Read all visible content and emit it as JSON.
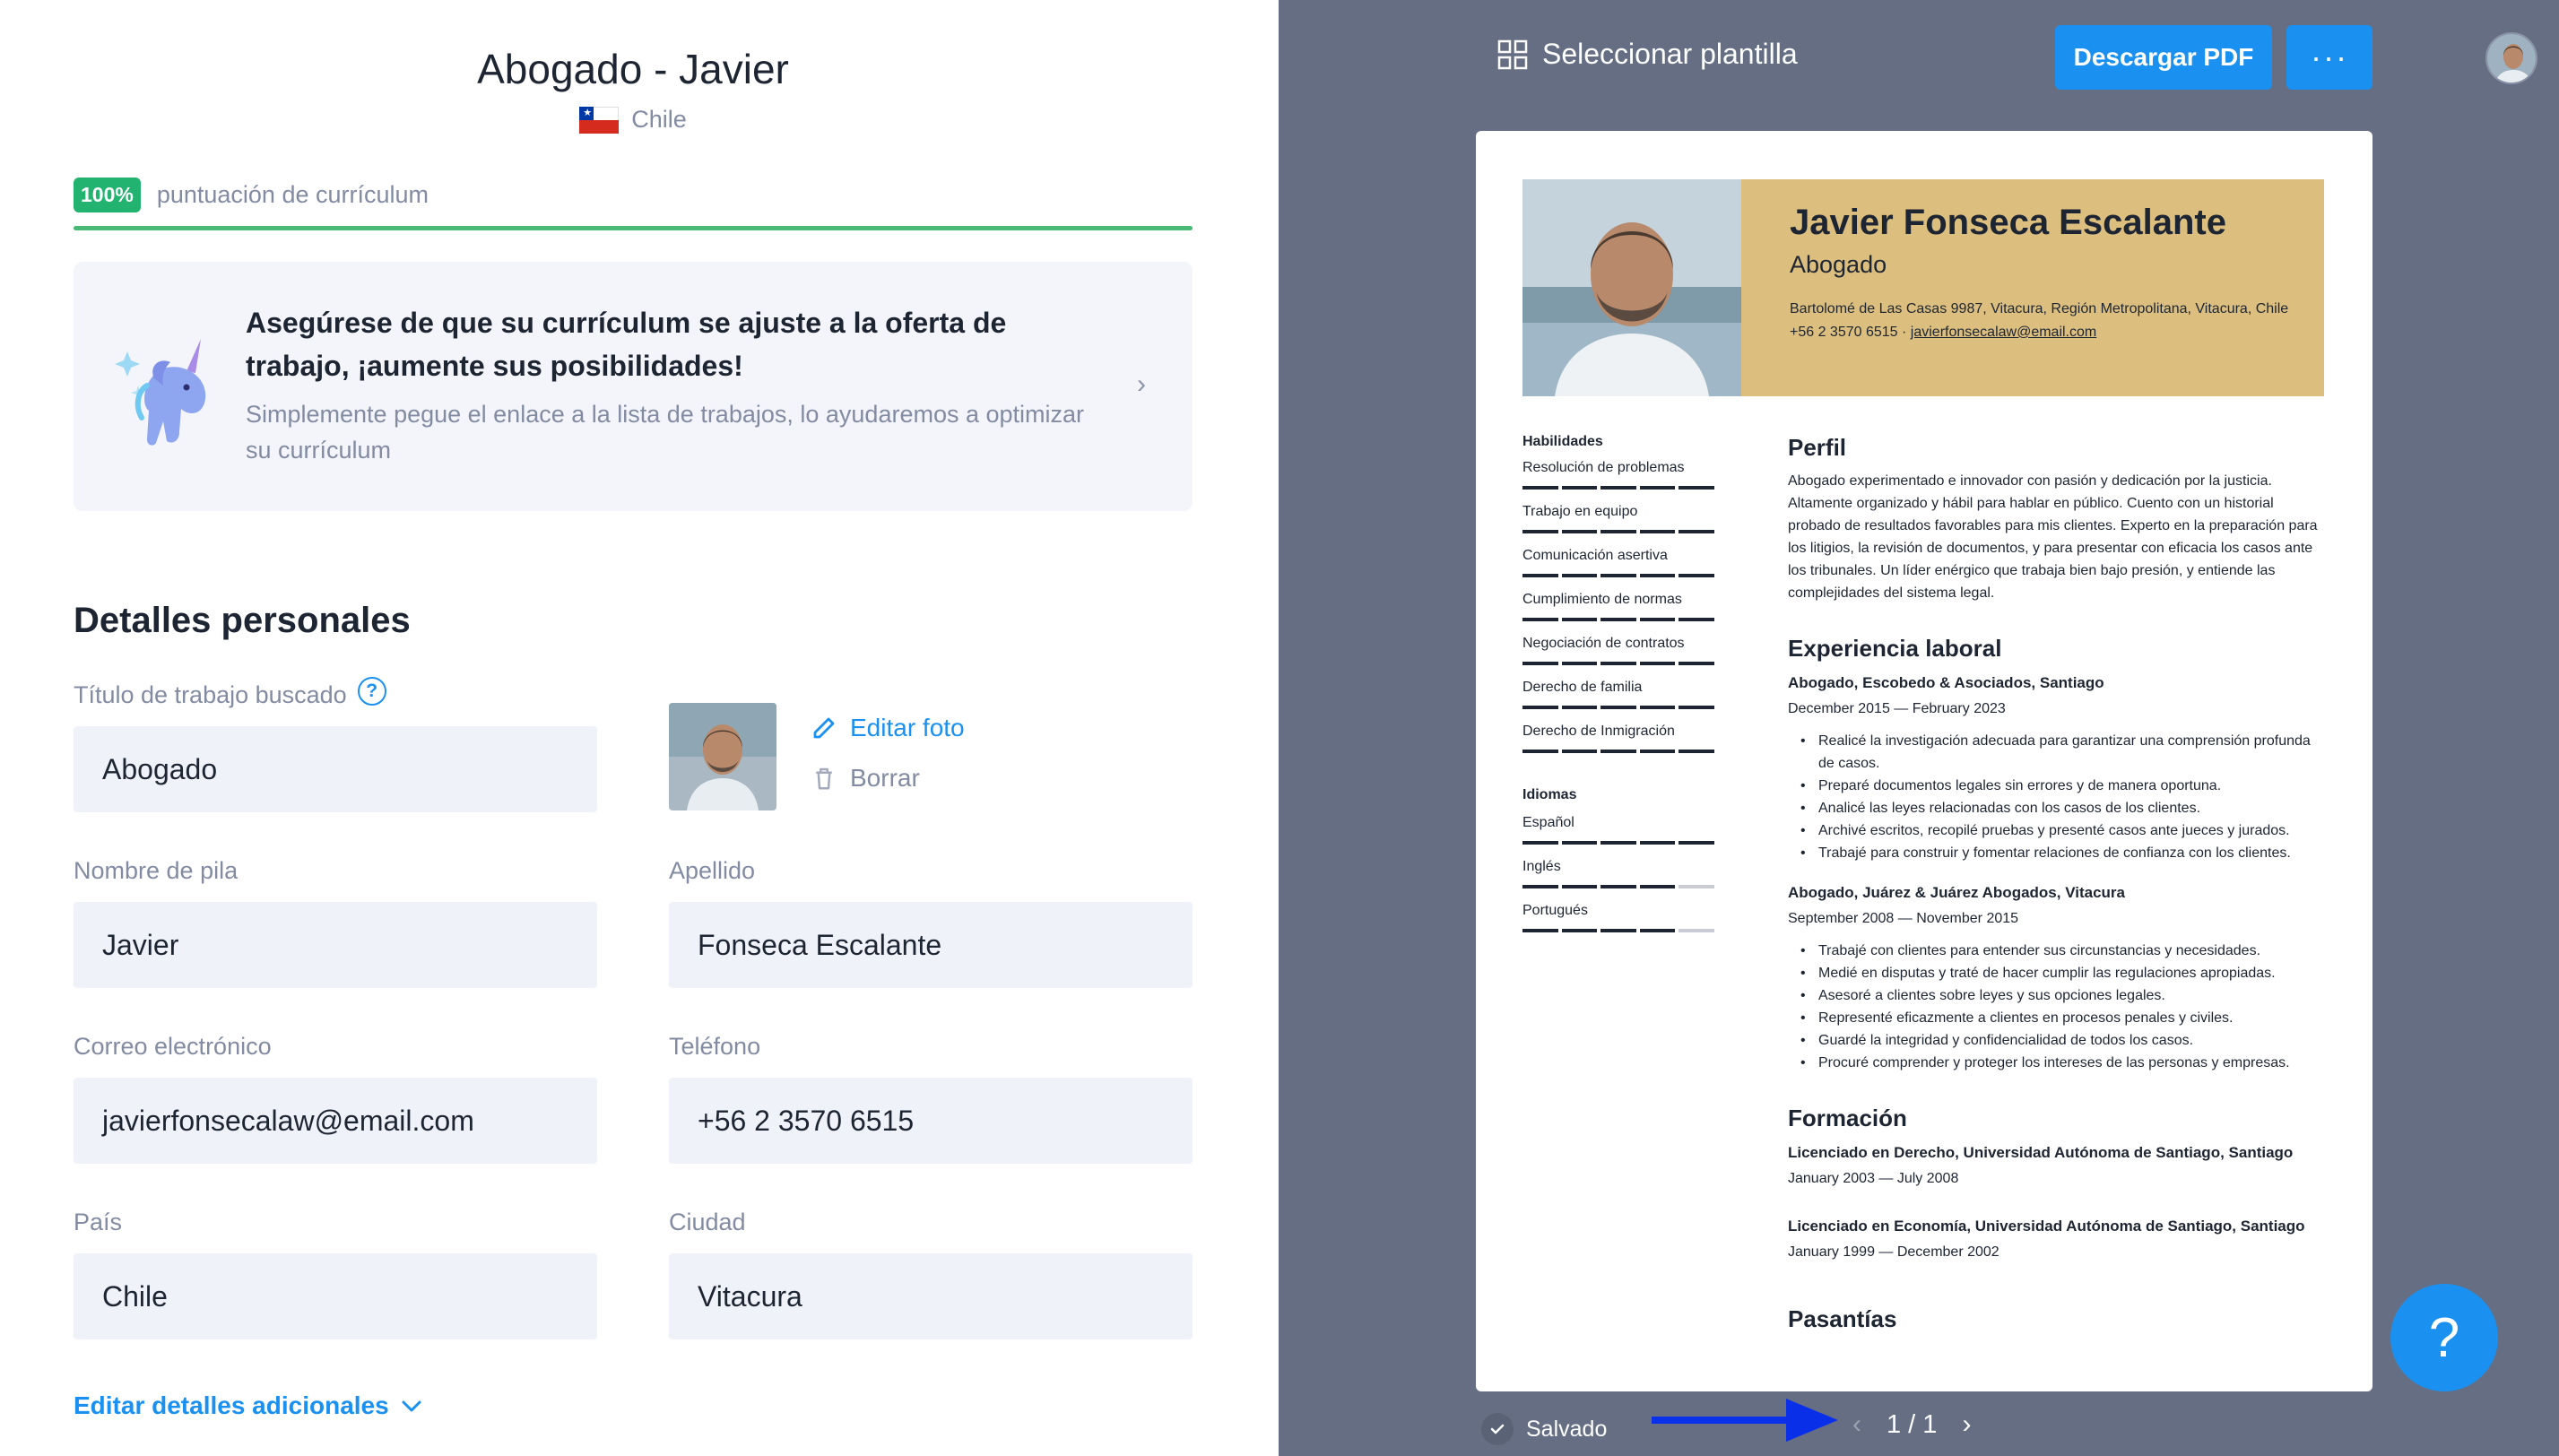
{
  "editor": {
    "doc_title": "Abogado - Javier",
    "country": "Chile",
    "score": {
      "badge": "100%",
      "label": "puntuación de currículum",
      "percent": 100
    },
    "tip": {
      "title": "Asegúrese de que su currículum se ajuste a la oferta de trabajo, ¡aumente sus posibilidades!",
      "body": "Simplemente pegue el enlace a la lista de trabajos, lo ayudaremos a optimizar su currículum"
    },
    "section_title": "Detalles personales",
    "fields": {
      "job_title": {
        "label": "Título de trabajo buscado",
        "value": "Abogado"
      },
      "first_name": {
        "label": "Nombre de pila",
        "value": "Javier"
      },
      "last_name": {
        "label": "Apellido",
        "value": "Fonseca Escalante"
      },
      "email": {
        "label": "Correo electrónico",
        "value": "javierfonsecalaw@email.com"
      },
      "phone": {
        "label": "Teléfono",
        "value": "+56 2 3570 6515"
      },
      "country": {
        "label": "País",
        "value": "Chile"
      },
      "city": {
        "label": "Ciudad",
        "value": "Vitacura"
      }
    },
    "photo": {
      "edit_label": "Editar foto",
      "delete_label": "Borrar"
    },
    "more_details_label": "Editar detalles adicionales",
    "help_glyph": "?"
  },
  "preview": {
    "select_template_label": "Seleccionar plantilla",
    "download_label": "Descargar PDF",
    "more_label": "···",
    "saved_label": "Salvado",
    "pager": {
      "current": "1 / 1"
    },
    "help_glyph": "?",
    "colors": {
      "accent": "#1a91f0",
      "header": "#dcbf7f",
      "panel": "#656e83",
      "arrow": "#0a2fe8"
    }
  },
  "resume": {
    "name": "Javier Fonseca Escalante",
    "job_title": "Abogado",
    "address": "Bartolomé de Las Casas 9987, Vitacura, Región Metropolitana, Vitacura, Chile",
    "phone": "+56 2 3570 6515",
    "separator": "·",
    "email": "javierfonsecalaw@email.com",
    "skills_heading": "Habilidades",
    "skills": [
      {
        "name": "Resolución de problemas",
        "level": 5
      },
      {
        "name": "Trabajo en equipo",
        "level": 5
      },
      {
        "name": "Comunicación asertiva",
        "level": 5
      },
      {
        "name": "Cumplimiento de normas",
        "level": 5
      },
      {
        "name": "Negociación de contratos",
        "level": 5
      },
      {
        "name": "Derecho de familia",
        "level": 5
      },
      {
        "name": "Derecho de Inmigración",
        "level": 5
      }
    ],
    "languages_heading": "Idiomas",
    "languages": [
      {
        "name": "Español",
        "level": 5
      },
      {
        "name": "Inglés",
        "level": 4
      },
      {
        "name": "Portugués",
        "level": 4
      }
    ],
    "profile_heading": "Perfil",
    "profile": "Abogado experimentado e innovador con pasión y dedicación por la justicia. Altamente organizado y hábil para hablar en público. Cuento con un historial probado de resultados favorables para mis clientes. Experto en la preparación para los litigios, la revisión de documentos, y para presentar con eficacia los casos ante los tribunales. Un líder enérgico que trabaja bien bajo presión, y entiende las complejidades del sistema legal.",
    "experience_heading": "Experiencia laboral",
    "jobs": [
      {
        "title": "Abogado, Escobedo & Asociados, Santiago",
        "dates": "December 2015 — February 2023",
        "bullets": [
          "Realicé la investigación adecuada para garantizar una comprensión profunda de casos.",
          "Preparé documentos legales sin errores y de manera oportuna.",
          "Analicé las leyes relacionadas con los casos de los clientes.",
          "Archivé escritos, recopilé pruebas y presenté casos ante jueces y jurados.",
          "Trabajé para construir y fomentar relaciones de confianza con los clientes."
        ]
      },
      {
        "title": "Abogado,  Juárez & Juárez Abogados, Vitacura",
        "dates": "September 2008 — November 2015",
        "bullets": [
          "Trabajé con clientes para entender sus circunstancias y necesidades.",
          "Medié en disputas y traté de hacer cumplir las regulaciones apropiadas.",
          "Asesoré a clientes sobre leyes y sus opciones legales.",
          "Representé eficazmente a clientes en procesos penales y civiles.",
          "Guardé la integridad y confidencialidad de todos los casos.",
          "Procuré comprender y proteger los intereses de las personas y empresas."
        ]
      }
    ],
    "education_heading": "Formación",
    "education": [
      {
        "title": "Licenciado en Derecho, Universidad Autónoma de Santiago, Santiago",
        "dates": "January 2003 — July 2008"
      },
      {
        "title": "Licenciado en Economía, Universidad Autónoma de Santiago, Santiago",
        "dates": "January 1999 — December 2002"
      }
    ],
    "internships_heading": "Pasantías"
  }
}
